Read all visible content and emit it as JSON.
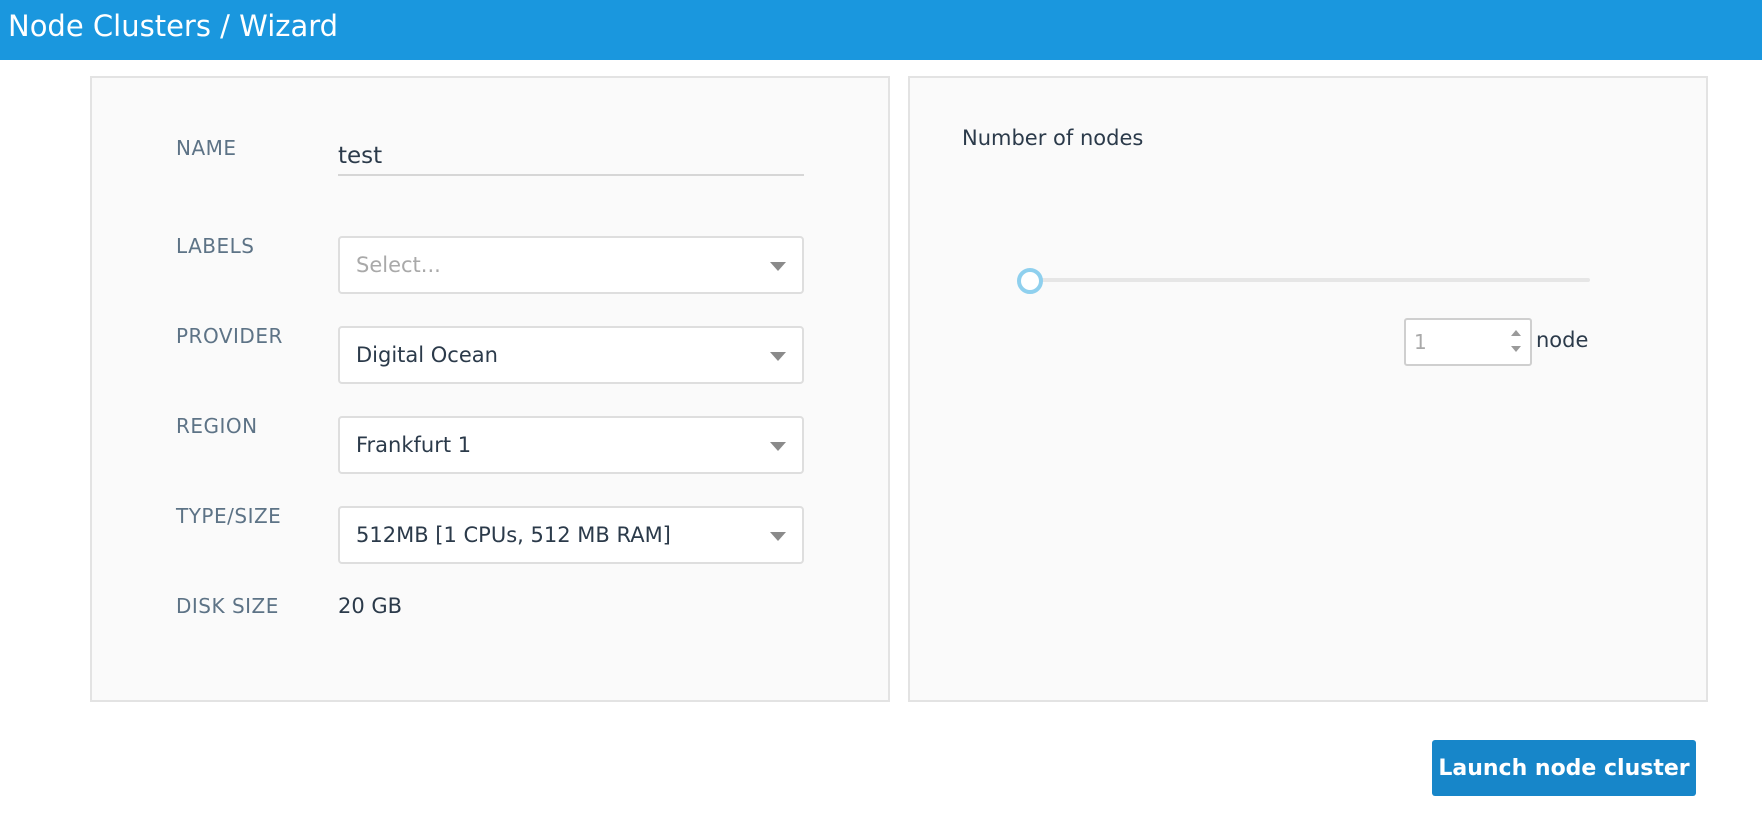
{
  "header": {
    "title": "Node Clusters / Wizard"
  },
  "form": {
    "name": {
      "label": "NAME",
      "value": "test"
    },
    "labels": {
      "label": "LABELS",
      "placeholder": "Select..."
    },
    "provider": {
      "label": "PROVIDER",
      "value": "Digital Ocean"
    },
    "region": {
      "label": "REGION",
      "value": "Frankfurt 1"
    },
    "type_size": {
      "label": "TYPE/SIZE",
      "value": "512MB [1 CPUs, 512 MB RAM]"
    },
    "disk_size": {
      "label": "DISK SIZE",
      "value": "20 GB"
    }
  },
  "nodes": {
    "title": "Number of nodes",
    "count": "1",
    "unit": "node",
    "slider_fraction": 0
  },
  "actions": {
    "launch_label": "Launch node cluster"
  },
  "colors": {
    "header_bg": "#1a97de",
    "button_bg": "#1786c9",
    "slider_handle": "#8fd0ee"
  },
  "icons": {
    "select_caret": "chevron-down-icon",
    "stepper_up": "caret-up-icon",
    "stepper_down": "caret-down-icon"
  }
}
